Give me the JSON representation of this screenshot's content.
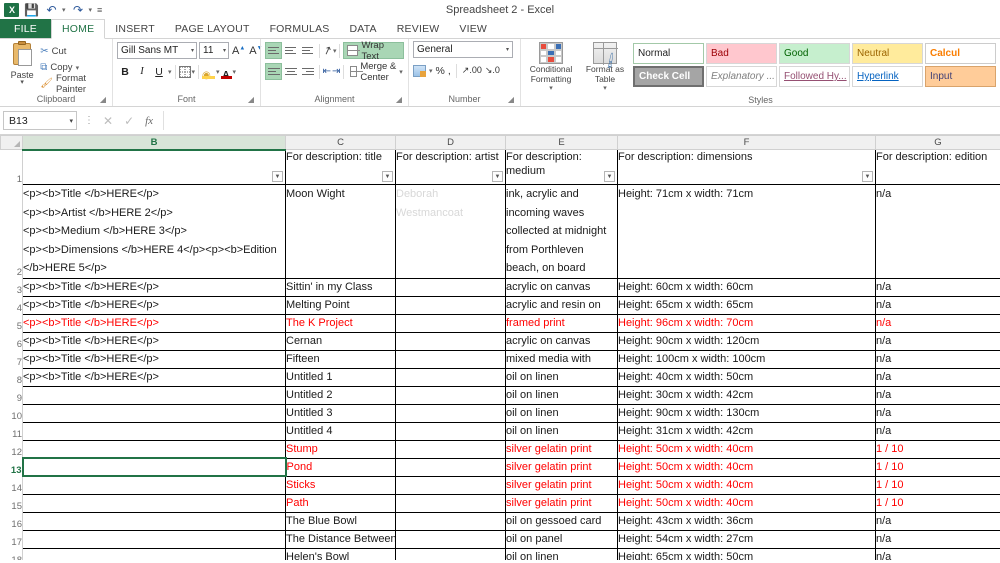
{
  "window": {
    "title": "Spreadsheet 2 - Excel"
  },
  "quick_access": {
    "logo": "excel-logo",
    "save": "save-icon",
    "undo": "undo-icon",
    "redo": "redo-icon",
    "more": "customize-icon"
  },
  "tabs": [
    {
      "label": "FILE",
      "active": false
    },
    {
      "label": "HOME",
      "active": true
    },
    {
      "label": "INSERT",
      "active": false
    },
    {
      "label": "PAGE LAYOUT",
      "active": false
    },
    {
      "label": "FORMULAS",
      "active": false
    },
    {
      "label": "DATA",
      "active": false
    },
    {
      "label": "REVIEW",
      "active": false
    },
    {
      "label": "VIEW",
      "active": false
    }
  ],
  "ribbon": {
    "clipboard": {
      "group_label": "Clipboard",
      "paste": "Paste",
      "cut": "Cut",
      "copy": "Copy",
      "format_painter": "Format Painter"
    },
    "font": {
      "group_label": "Font",
      "font_name": "Gill Sans MT",
      "font_size": "11",
      "bold": "B",
      "italic": "I",
      "underline": "U"
    },
    "alignment": {
      "group_label": "Alignment",
      "wrap_text": "Wrap Text",
      "merge_center": "Merge & Center"
    },
    "number": {
      "group_label": "Number",
      "format": "General",
      "percent": "%",
      "comma": ","
    },
    "styles": {
      "group_label": "Styles",
      "conditional_formatting": "Conditional Formatting",
      "format_as_table": "Format as Table",
      "cells": [
        {
          "label": "Normal",
          "class": "s-normal"
        },
        {
          "label": "Bad",
          "class": "s-bad"
        },
        {
          "label": "Good",
          "class": "s-good"
        },
        {
          "label": "Neutral",
          "class": "s-neutral"
        },
        {
          "label": "Calcul",
          "class": "s-calc"
        },
        {
          "label": "Check Cell",
          "class": "s-check"
        },
        {
          "label": "Explanatory ...",
          "class": "s-expl"
        },
        {
          "label": "Followed Hy...",
          "class": "s-fhl"
        },
        {
          "label": "Hyperlink",
          "class": "s-hl"
        },
        {
          "label": "Input",
          "class": "s-input"
        }
      ]
    }
  },
  "formula_bar": {
    "name_box": "B13",
    "formula": ""
  },
  "sheet": {
    "columns": [
      {
        "letter": "B",
        "selected": true
      },
      {
        "letter": "C",
        "selected": false
      },
      {
        "letter": "D",
        "selected": false
      },
      {
        "letter": "E",
        "selected": false
      },
      {
        "letter": "F",
        "selected": false
      },
      {
        "letter": "G",
        "selected": false
      }
    ],
    "header_row": {
      "number": "1",
      "B": "",
      "C": "For description: title",
      "D": "For description: artist",
      "E": "For description: medium",
      "F": "For description: dimensions",
      "G": "For description: edition"
    },
    "rows": [
      {
        "number": "2",
        "B": "<p><b>Title </b>HERE</p>\n<p><b>Artist </b>HERE 2</p>\n<p><b>Medium </b>HERE 3</p>\n<p><b>Dimensions </b>HERE 4</p><p><b>Edition </b>HERE 5</p>",
        "C": "Moon Wight",
        "D": "Deborah Westmancoat",
        "E": "ink, acrylic and incoming waves collected at midnight from Porthleven beach, on board",
        "F": "Height: 71cm x width: 71cm",
        "G": "n/a",
        "red": false,
        "tall": true,
        "selected": false
      },
      {
        "number": "3",
        "B": "<p><b>Title </b>HERE</p>",
        "C": "Sittin' in my Class",
        "D": "",
        "E": "acrylic on canvas",
        "F": "Height: 60cm x width: 60cm",
        "G": "n/a",
        "red": false,
        "tall": false,
        "selected": false
      },
      {
        "number": "4",
        "B": "<p><b>Title </b>HERE</p>",
        "C": "Melting Point",
        "D": "",
        "E": "acrylic and resin on",
        "F": "Height: 65cm x width: 65cm",
        "G": "n/a",
        "red": false,
        "tall": false,
        "selected": false
      },
      {
        "number": "5",
        "B": "<p><b>Title </b>HERE</p>",
        "C": "The K Project",
        "D": "",
        "E": "framed print",
        "F": "Height: 96cm x width: 70cm",
        "G": "n/a",
        "red": true,
        "tall": false,
        "selected": false
      },
      {
        "number": "6",
        "B": "<p><b>Title </b>HERE</p>",
        "C": "Cernan",
        "D": "",
        "E": "acrylic on canvas",
        "F": "Height: 90cm x width: 120cm",
        "G": "n/a",
        "red": false,
        "tall": false,
        "selected": false
      },
      {
        "number": "7",
        "B": "<p><b>Title </b>HERE</p>",
        "C": "Fifteen",
        "D": "",
        "E": "mixed media with",
        "F": "Height: 100cm x width: 100cm",
        "G": "n/a",
        "red": false,
        "tall": false,
        "selected": false
      },
      {
        "number": "8",
        "B": "<p><b>Title </b>HERE</p>",
        "C": "Untitled 1",
        "D": "",
        "E": "oil on linen",
        "F": "Height: 40cm x width: 50cm",
        "G": "n/a",
        "red": false,
        "tall": false,
        "selected": false
      },
      {
        "number": "9",
        "B": "",
        "C": "Untitled 2",
        "D": "",
        "E": "oil on linen",
        "F": "Height: 30cm x width: 42cm",
        "G": "n/a",
        "red": false,
        "tall": false,
        "selected": false
      },
      {
        "number": "10",
        "B": "",
        "C": "Untitled 3",
        "D": "",
        "E": "oil on linen",
        "F": "Height: 90cm x width: 130cm",
        "G": "n/a",
        "red": false,
        "tall": false,
        "selected": false
      },
      {
        "number": "11",
        "B": "",
        "C": "Untitled 4",
        "D": "",
        "E": "oil on linen",
        "F": "Height: 31cm x width: 42cm",
        "G": "n/a",
        "red": false,
        "tall": false,
        "selected": false
      },
      {
        "number": "12",
        "B": "",
        "C": "Stump",
        "D": "",
        "E": "silver gelatin print",
        "F": "Height: 50cm x width: 40cm",
        "G": "1 / 10",
        "red": true,
        "tall": false,
        "selected": false
      },
      {
        "number": "13",
        "B": "",
        "C": "Pond",
        "D": "",
        "E": "silver gelatin print",
        "F": "Height: 50cm x width: 40cm",
        "G": "1 / 10",
        "red": true,
        "tall": false,
        "selected": true
      },
      {
        "number": "14",
        "B": "",
        "C": "Sticks",
        "D": "",
        "E": "silver gelatin print",
        "F": "Height: 50cm x width: 40cm",
        "G": "1 / 10",
        "red": true,
        "tall": false,
        "selected": false
      },
      {
        "number": "15",
        "B": "",
        "C": "Path",
        "D": "",
        "E": "silver gelatin print",
        "F": "Height: 50cm x width: 40cm",
        "G": "1 / 10",
        "red": true,
        "tall": false,
        "selected": false
      },
      {
        "number": "16",
        "B": "",
        "C": "The Blue Bowl",
        "D": "",
        "E": "oil on gessoed card",
        "F": "Height: 43cm x width: 36cm",
        "G": "n/a",
        "red": false,
        "tall": false,
        "selected": false
      },
      {
        "number": "17",
        "B": "",
        "C": "The Distance Between",
        "D": "",
        "E": "oil on panel",
        "F": "Height: 54cm x width: 27cm",
        "G": "n/a",
        "red": false,
        "tall": false,
        "selected": false
      },
      {
        "number": "18",
        "B": "",
        "C": "Helen's Bowl",
        "D": "",
        "E": "oil on linen",
        "F": "Height: 65cm x width: 50cm",
        "G": "n/a",
        "red": false,
        "tall": false,
        "selected": false
      }
    ]
  }
}
